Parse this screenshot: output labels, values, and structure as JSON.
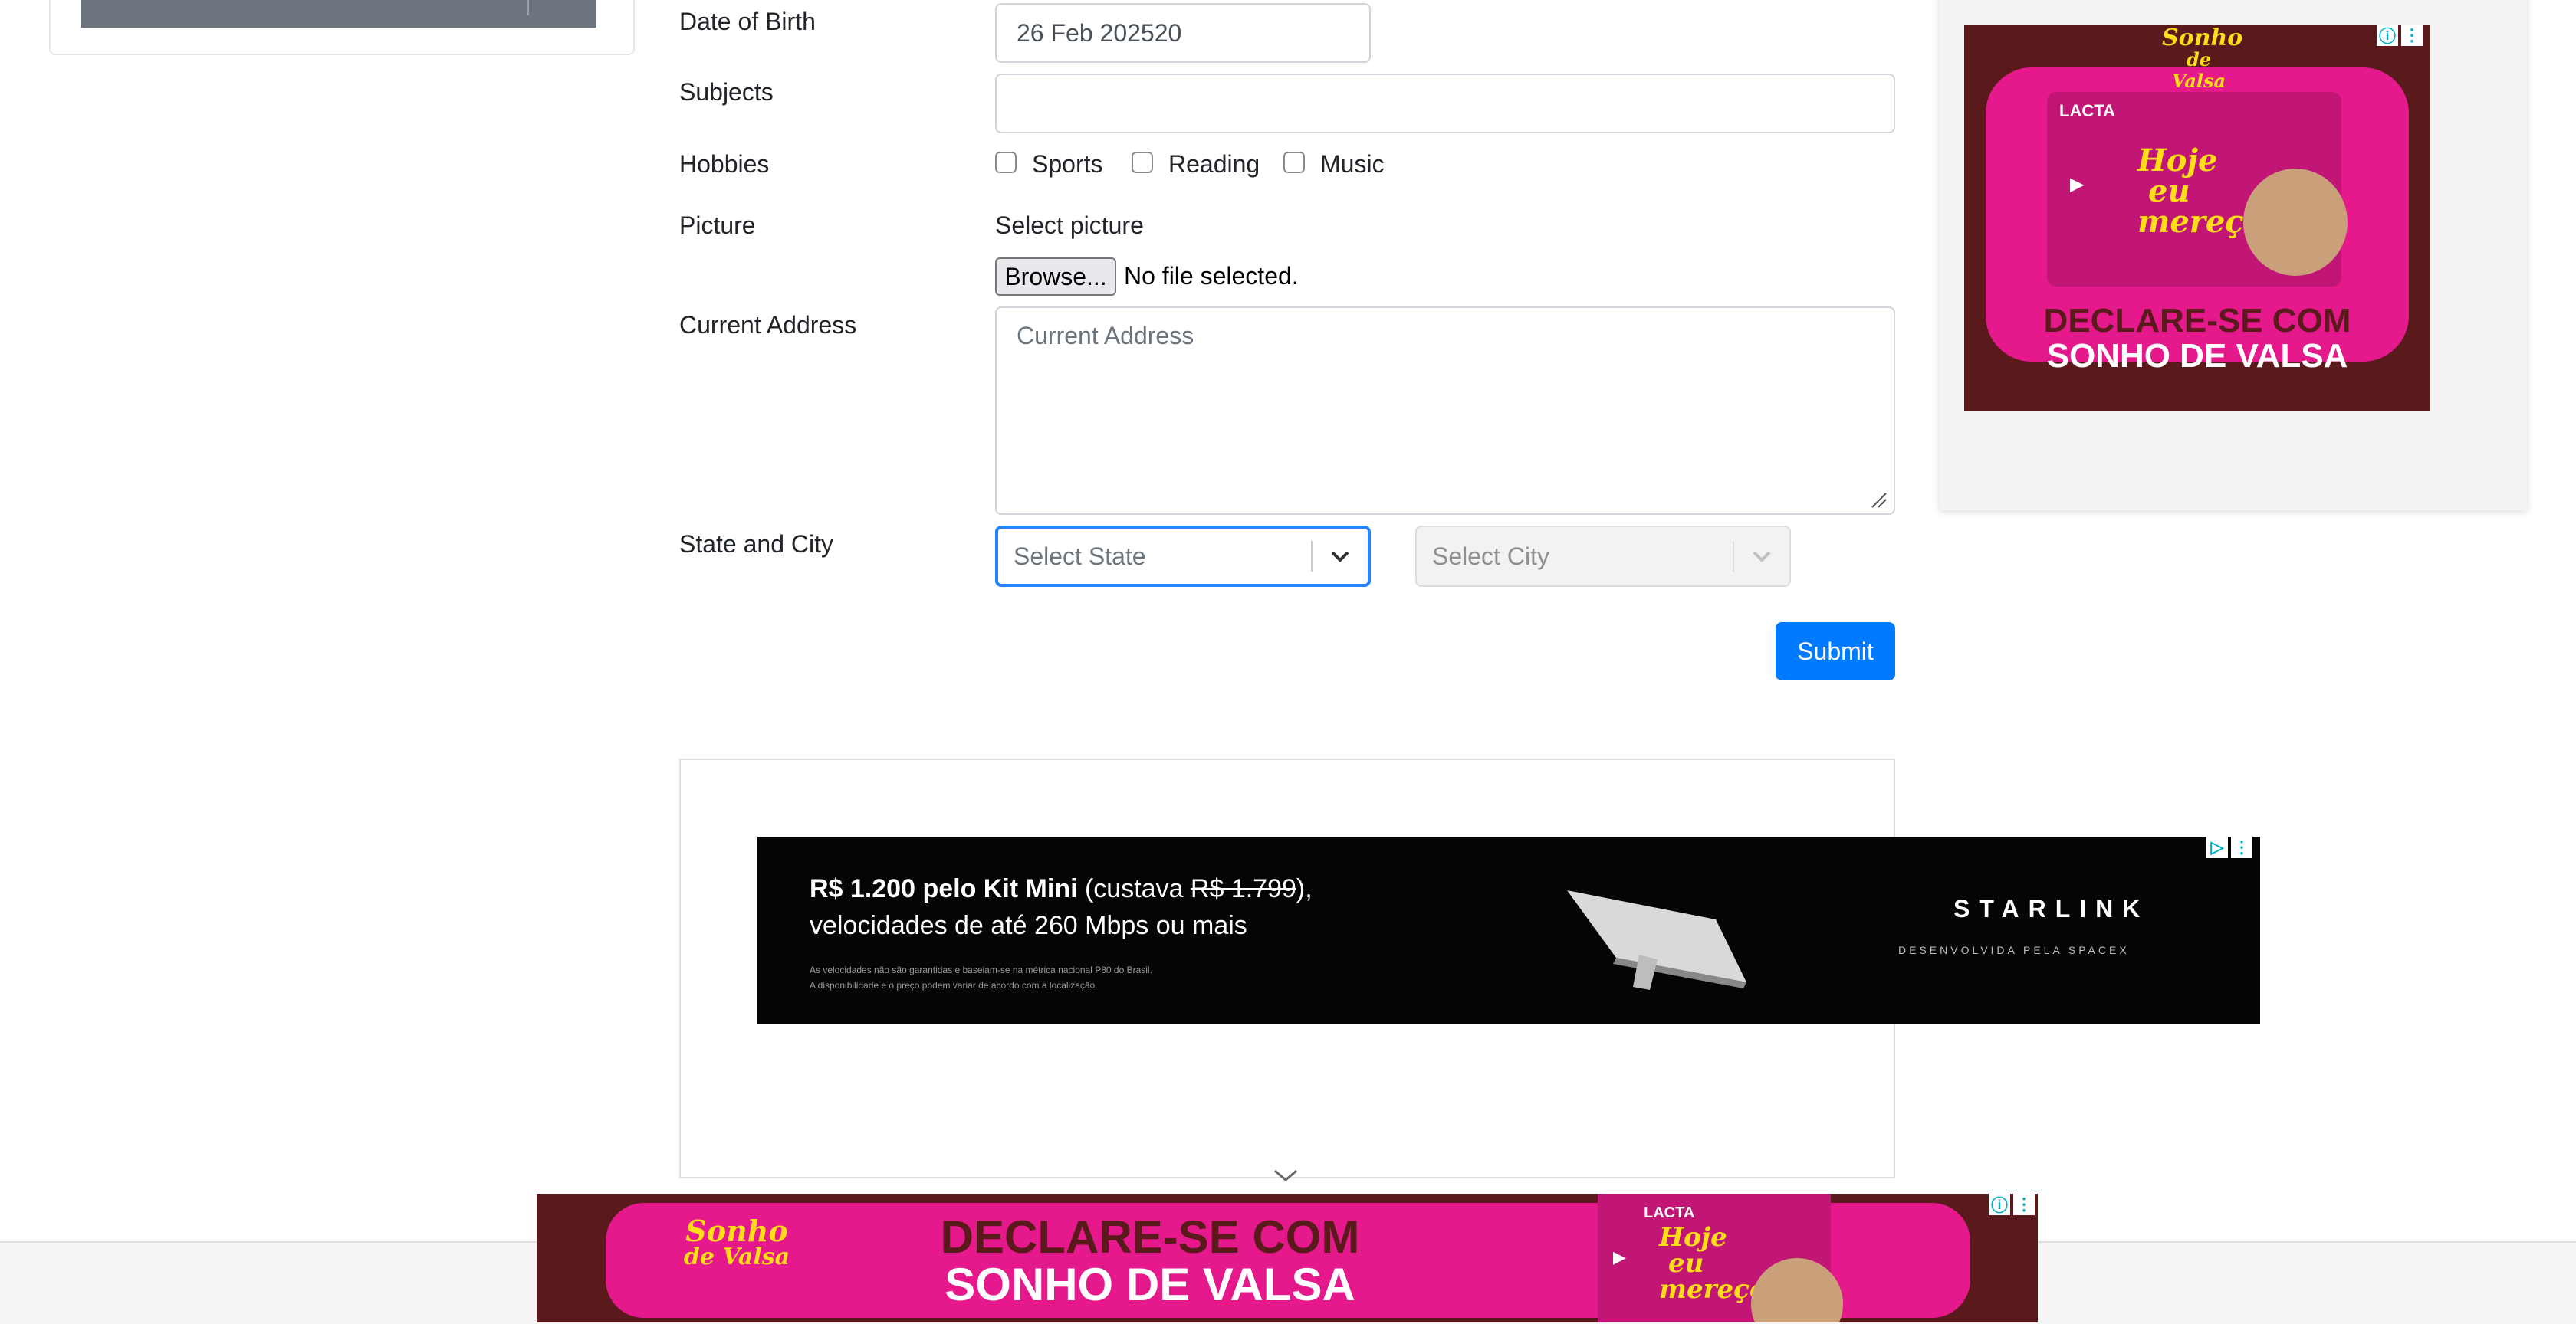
{
  "form": {
    "date_of_birth": {
      "label": "Date of Birth",
      "value": "26 Feb 202520"
    },
    "subjects": {
      "label": "Subjects",
      "value": ""
    },
    "hobbies": {
      "label": "Hobbies",
      "options": [
        {
          "label": "Sports",
          "checked": false
        },
        {
          "label": "Reading",
          "checked": false
        },
        {
          "label": "Music",
          "checked": false
        }
      ]
    },
    "picture": {
      "label": "Picture",
      "select_text": "Select picture",
      "browse_label": "Browse...",
      "file_status": "No file selected."
    },
    "current_address": {
      "label": "Current Address",
      "placeholder": "Current Address"
    },
    "state_city": {
      "label": "State and City",
      "state_placeholder": "Select State",
      "city_placeholder": "Select City"
    },
    "submit_label": "Submit"
  },
  "starlink_ad": {
    "price_bold": "R$ 1.200 pelo Kit Mini",
    "price_mid": " (custava ",
    "price_old": "R$ 1.799",
    "price_end": "),",
    "line2": "velocidades de até 260 Mbps ou mais",
    "fine1": "As velocidades não são garantidas e baseiam-se na métrica nacional P80 do Brasil.",
    "fine2": "A disponibilidade e o preço podem variar de acordo com a localização.",
    "brand": "STARLINK",
    "sub": "DESENVOLVIDA PELA SPACEX"
  },
  "sonho_ad": {
    "logo_line1": "Sonho",
    "logo_line2": "de Valsa",
    "brand_tag": "LACTA",
    "wrapper_text_1": "Hoje",
    "wrapper_text_2": "eu",
    "wrapper_text_3": "mereço",
    "promo_line1": "DECLARE-SE COM",
    "promo_line2": "SONHO DE VALSA"
  },
  "ad_badges": {
    "info": "ⓘ",
    "menu": "⋮",
    "play": "▷"
  },
  "colors": {
    "primary": "#007bff",
    "select_focus": "#2684ff",
    "sonho_pink": "#e6198c",
    "sonho_dark": "#5a1a1c",
    "sonho_yellow": "#ffde17"
  }
}
